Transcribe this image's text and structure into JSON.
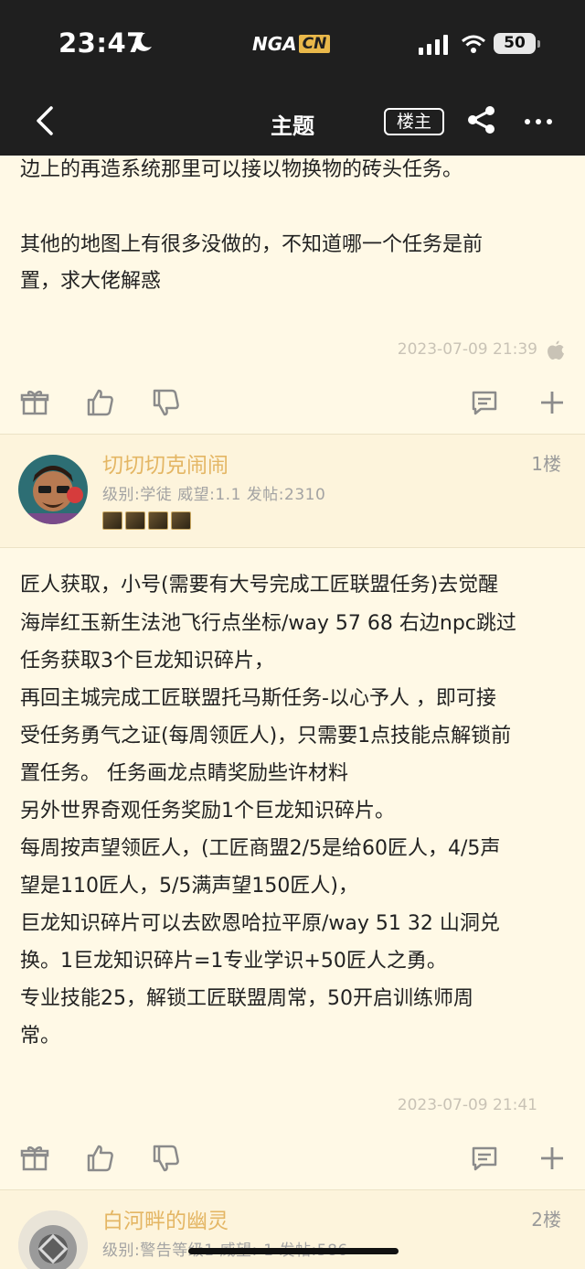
{
  "status_bar": {
    "time": "23:47",
    "logo_main": "NGA",
    "logo_suffix": "CN",
    "battery": "50"
  },
  "nav": {
    "title": "主题",
    "op_label": "楼主"
  },
  "post0": {
    "lines": [
      "边上的再造系统那里可以接以物换物的砖头任务。",
      "",
      "其他的地图上有很多没做的，不知道哪一个任务是前",
      "置，求大佬解惑"
    ],
    "timestamp": "2023-07-09 21:39"
  },
  "post1": {
    "username": "切切切克闹闹",
    "floor": "1楼",
    "meta": "级别:学徒  威望:1.1  发帖:2310",
    "lines": [
      "匠人获取，小号(需要有大号完成工匠联盟任务)去觉醒",
      "海岸红玉新生法池飞行点坐标/way 57 68 右边npc跳过",
      "任务获取3个巨龙知识碎片，",
      "再回主城完成工匠联盟托马斯任务-以心予人 ，即可接",
      "受任务勇气之证(每周领匠人)，只需要1点技能点解锁前",
      "置任务。 任务画龙点睛奖励些许材料",
      "另外世界奇观任务奖励1个巨龙知识碎片。",
      "每周按声望领匠人，(工匠商盟2/5是给60匠人，4/5声",
      "望是110匠人，5/5满声望150匠人)，",
      "巨龙知识碎片可以去欧恩哈拉平原/way 51 32 山洞兑",
      "换。1巨龙知识碎片=1专业学识+50匠人之勇。",
      "专业技能25，解锁工匠联盟周常，50开启训练师周",
      "常。"
    ],
    "timestamp": "2023-07-09 21:41"
  },
  "post2": {
    "username": "白河畔的幽灵",
    "floor": "2楼",
    "meta": "级别:警告等级1  威望:-1  发帖:586"
  },
  "colors": {
    "background": "#fff9e6",
    "header_bg": "#fdf4dc",
    "username": "#e4b664",
    "bar": "#1f1f1f"
  }
}
